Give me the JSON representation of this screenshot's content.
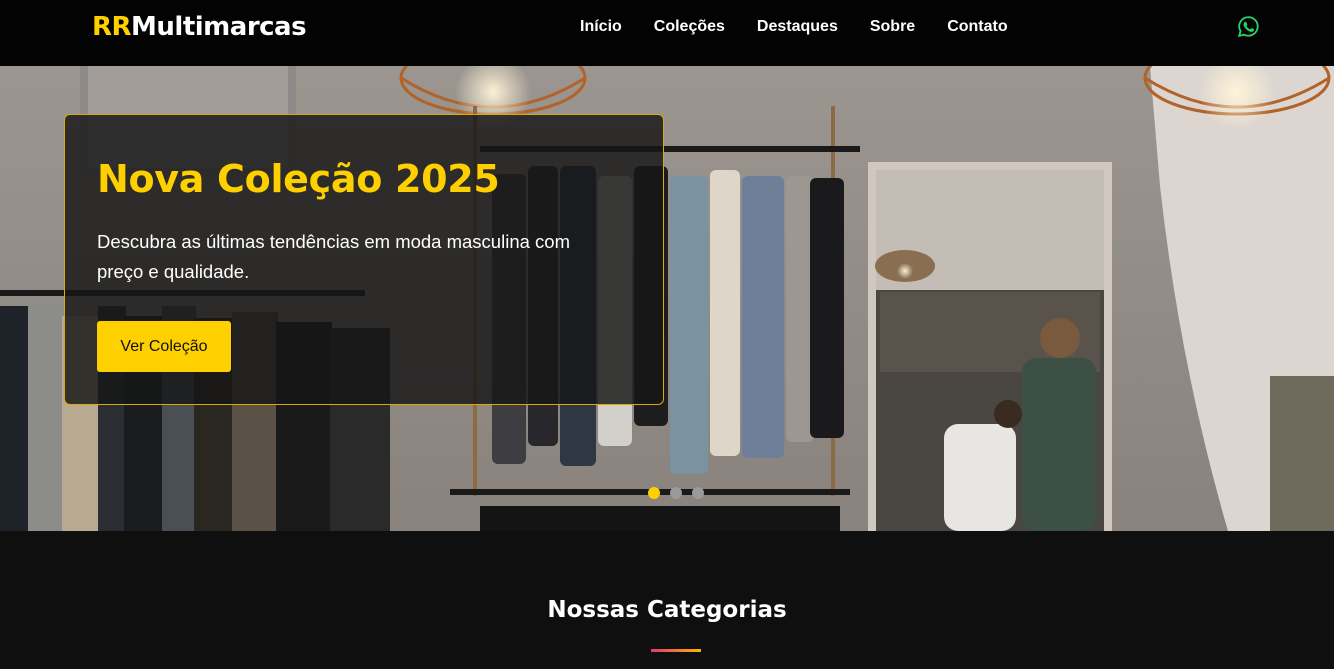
{
  "header": {
    "logo_accent": "RR",
    "logo_rest": "Multimarcas",
    "nav": [
      "Início",
      "Coleções",
      "Destaques",
      "Sobre",
      "Contato"
    ],
    "whatsapp_icon": "whatsapp-icon",
    "whatsapp_color": "#25d366"
  },
  "hero": {
    "title": "Nova Coleção 2025",
    "text": "Descubra as últimas tendências em moda masculina com preço e qualidade.",
    "button": "Ver Coleção",
    "slides": 3,
    "active_slide": 1
  },
  "categories": {
    "title": "Nossas Categorias"
  },
  "colors": {
    "accent": "#ffd000",
    "background": "#0f0f0f",
    "header": "#030303"
  }
}
